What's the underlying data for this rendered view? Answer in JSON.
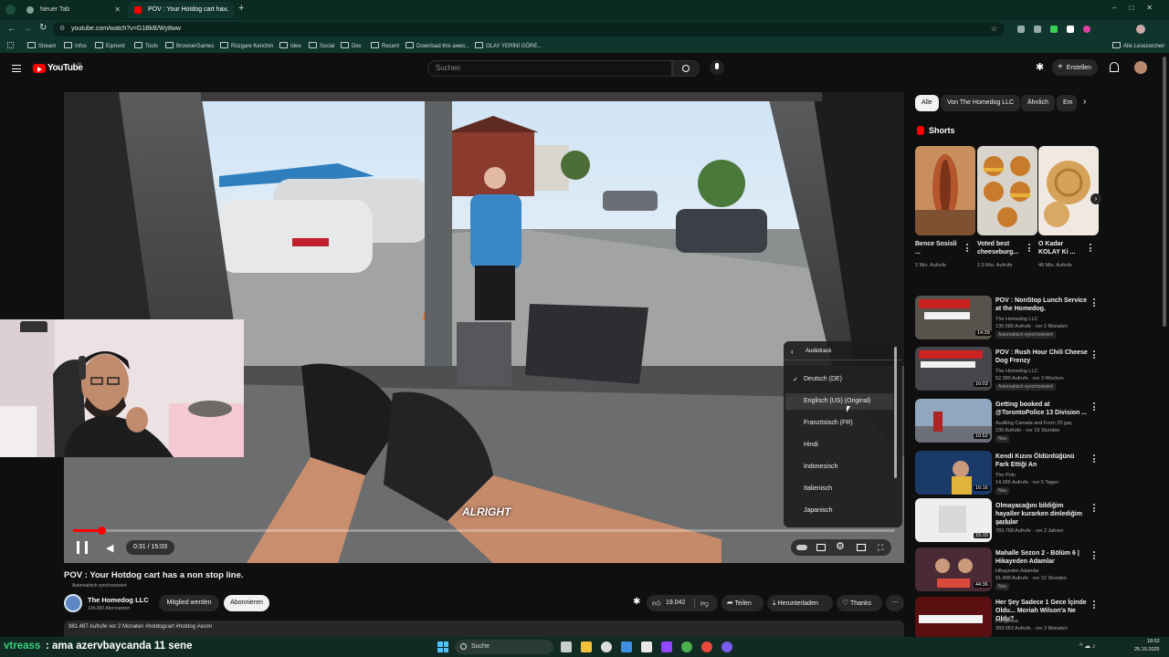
{
  "browser": {
    "tabs": [
      {
        "label": "Neuer Tab"
      },
      {
        "label": "POV : Your Hotdog cart ha..."
      }
    ],
    "url": "youtube.com/watch?v=G1BkB/Wy8ww",
    "bookmarks": [
      "Stream",
      "Infos",
      "Eqment",
      "Tools",
      "BrowserGames",
      "Rüzgare Kenchin",
      "Idee",
      "Social",
      "Dev",
      "Recent",
      "Download this awes...",
      "OLAY YERİNİ GÖRE..."
    ],
    "bookmarks_right": "Alle Lesezeichen",
    "colors": {
      "frame": "#0b2a22",
      "toolbar": "#10352c"
    }
  },
  "youtube": {
    "logo_text": "YouTube",
    "logo_badge": "DE",
    "search_placeholder": "Suchen",
    "create_label": "Erstellen",
    "accent": "#ff0000"
  },
  "player": {
    "time": "0:31 / 15:03",
    "subtitle": "ALRIGHT",
    "progress_fraction": 0.034,
    "audiotrack_menu": {
      "title": "Audiotrack",
      "items": [
        {
          "label": "Deutsch (DE)",
          "checked": true
        },
        {
          "label": "Englisch (US) (Original)",
          "checked": false
        },
        {
          "label": "Französisch (FR)",
          "checked": false
        },
        {
          "label": "Hindi",
          "checked": false
        },
        {
          "label": "Indonesisch",
          "checked": false
        },
        {
          "label": "Italienisch",
          "checked": false
        },
        {
          "label": "Japanisch",
          "checked": false
        }
      ]
    }
  },
  "video_info": {
    "title": "POV : Your Hotdog cart has a non stop line.",
    "auto_dub": "Automatisch synchronisiert",
    "channel": "The Homedog LLC",
    "subscribers": "134.000 Abonnenten",
    "join_label": "Mitglied werden",
    "subscribe_label": "Abonnieren",
    "likes": "19.042",
    "share_label": "Teilen",
    "download_label": "Herunterladen",
    "thanks_label": "Thanks",
    "description_line": "981.487 Aufrufe  vor 2 Monaten  #hotdogcart #hotdog #asmr"
  },
  "sidebar": {
    "chips": [
      "Alle",
      "Von The Homedog LLC",
      "Ähnlich",
      "Em"
    ],
    "shorts_heading": "Shorts",
    "shorts": [
      {
        "title": "Bence Sosisli ...",
        "views": "2 Mio. Aufrufe"
      },
      {
        "title": "Voted best cheeseburg...",
        "views": "2,5 Mio. Aufrufe"
      },
      {
        "title": "O Kadar KOLAY Ki ...",
        "views": "48 Mio. Aufrufe"
      }
    ],
    "related": [
      {
        "title": "POV : NonStop Lunch Service at the Homedog.",
        "channel": "The Homedog LLC",
        "meta": "130.586 Aufrufe · vor 2 Monaten",
        "tag": "Automatisch synchronisiert",
        "duration": "14:39"
      },
      {
        "title": "POV : Rush Hour Chili Cheese Dog Frenzy",
        "channel": "The Homedog LLC",
        "meta": "52.389 Aufrufe · vor 3 Wochen",
        "tag": "Automatisch synchronisiert",
        "duration": "16:03"
      },
      {
        "title": "Getting booked at @TorontoPolice 13 Division ...",
        "channel": "Auditing Canada and Form 33 gay",
        "meta": "236 Aufrufe · vor 19 Stunden",
        "tag": "Neu",
        "duration": "10:52"
      },
      {
        "title": "Kendi Kızını Öldürdüğünü Fark Ettiği An",
        "channel": "The Pokı",
        "meta": "14.056 Aufrufe · vor 5 Tagen",
        "tag": "Neu",
        "duration": "16:16"
      },
      {
        "title": "Olmayacağını bildiğim hayaller kurarken dinlediğim şarkılar",
        "channel": "Merece",
        "meta": "783.768 Aufrufe · vor 2 Jahren",
        "tag": "",
        "duration": "15:15"
      },
      {
        "title": "Mahalle Sezon 2 - Bölüm 6 | Hikayeden Adamlar",
        "channel": "Hikayeden Adamlar",
        "meta": "91.489 Aufrufe · vor 22 Stunden",
        "tag": "Neu",
        "duration": "44:36"
      },
      {
        "title": "Her Şey Sadece 1 Gece İçinde Oldu... Moriah Wilson'a Ne Oldu?",
        "channel": "Pangeosa",
        "meta": "393.053 Aufrufe · vor 3 Monaten",
        "tag": "",
        "duration": ""
      }
    ]
  },
  "overlay": {
    "chat_user": "vtreass",
    "chat_message": ": ama azervbaycanda 11 sene"
  },
  "taskbar": {
    "search_placeholder": "Suche",
    "time": "18:52",
    "date": "25.10.2025"
  }
}
